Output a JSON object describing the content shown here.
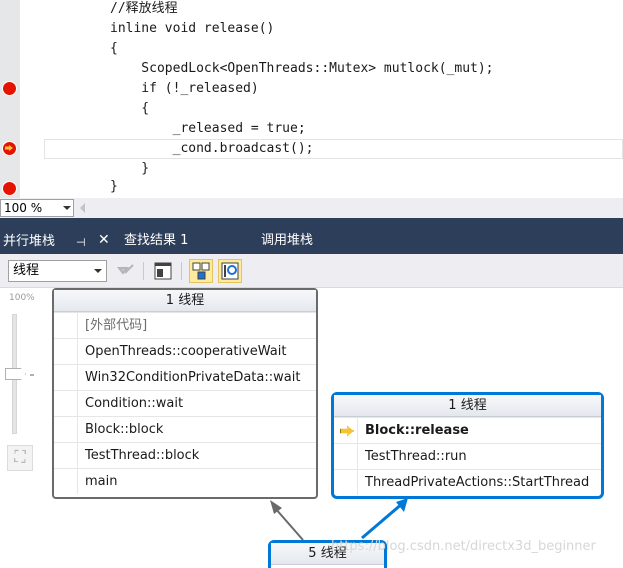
{
  "editor": {
    "lines": [
      "//释放线程",
      "inline void release()",
      "{",
      "    ScopedLock<OpenThreads::Mutex> mutlock(_mut);",
      "    if (!_released)",
      "    {",
      "        _released = true;",
      "        _cond.broadcast();",
      "    }",
      "}"
    ],
    "zoom_value": "100 %"
  },
  "tool_window": {
    "tabs": [
      "并行堆栈",
      "查找结果 1",
      "调用堆栈"
    ],
    "pin_icon": "pin-icon",
    "close_icon": "close-icon"
  },
  "toolbar": {
    "view_combo": "线程",
    "icons": [
      "toggle-method-view-icon",
      "open-window-icon",
      "auto-scroll-icon",
      "toggle-zoom-control-icon"
    ]
  },
  "canvas": {
    "zoom_label": "100%",
    "nodes": [
      {
        "header": "1 线程",
        "frames": [
          "[外部代码]",
          "OpenThreads::cooperativeWait",
          "Win32ConditionPrivateData::wait",
          "Condition::wait",
          "Block::block",
          "TestThread::block",
          "main"
        ]
      },
      {
        "header": "1 线程",
        "frames": [
          "Block::release",
          "TestThread::run",
          "ThreadPrivateActions::StartThread"
        ]
      },
      {
        "header": "5 线程",
        "frames": []
      }
    ],
    "watermark": "https://blog.csdn.net/directx3d_beginner",
    "colors": {
      "focus": "#0078d7",
      "tabbar": "#2d3e5a",
      "breakpoint": "#e51400"
    }
  }
}
